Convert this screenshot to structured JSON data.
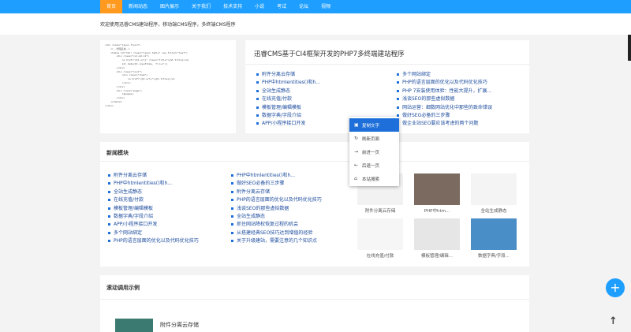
{
  "nav": {
    "items": [
      "首页",
      "新闻动态",
      "图片展示",
      "关于我们",
      "技术支持",
      "小说",
      "考试",
      "论坛",
      "视频"
    ],
    "active_index": 0
  },
  "welcome": {
    "text": "欢迎使用迅睿CMS建站程序，移动端CMS程序，多终端CMS程序"
  },
  "code": {
    "lines": [
      "<div class=\"layui-fluid\">",
      "    <!--代码区块-->",
      "    <table id=\"tbl\" class=\"layui-table\" lay-filter=\"test\">",
      "        <div class=\"col-md-12\">",
      "            <a href=\"{$t.url}\" class=\"title\">{$t.title}</a>",
      "            {dr_date($t.inputtime, 'Y-m-d')}",
      "        </div>",
      "        <div class=\"list\">",
      "            <div class=\"item\">",
      "                <a href=\"{$t.url}\">{$t.title}</a>",
      "            </div>",
      "        </div>",
      "        <div class=\"page\">",
      "            {$pages}",
      "        </div>",
      "    </table>",
      "</div>"
    ]
  },
  "intro": {
    "title": "迅睿CMS基于CI4框架开发的PHP7多终端建站程序",
    "col1": [
      "附件分离云存储",
      "PHP中htmlentities()和h...",
      "全站生成静态",
      "在线充值/付款",
      "模板管理/编辑模板",
      "数据字典/字段介绍",
      "APP/小程序接口开发"
    ],
    "col2": [
      "多个网站绑定",
      "PHP的语言层面的优化以及代码优化技巧",
      "PHP 7安装使用体验：性能大提升，扩展...",
      "浅谈SEO的那些虚拟数据",
      "网站运营：细数网站优化中那些的致命错误",
      "做好SEO必备的三步骤",
      "做企业站SEO要应该考虑的两个问题"
    ]
  },
  "menu": {
    "items": [
      {
        "icon": "copy-icon",
        "glyph": "▣",
        "label": "复制文字"
      },
      {
        "icon": "refresh-icon",
        "glyph": "↻",
        "label": "刷新页面"
      },
      {
        "icon": "forward-icon",
        "glyph": "→",
        "label": "前进一页"
      },
      {
        "icon": "back-icon",
        "glyph": "←",
        "label": "后退一页"
      },
      {
        "icon": "home-search-icon",
        "glyph": "⌂",
        "label": "本站搜索"
      }
    ],
    "active_index": 0
  },
  "news": {
    "title": "新闻模块",
    "col1": [
      "附件分离云存储",
      "PHP中htmlentities()和h...",
      "全站生成静态",
      "在线充值/付款",
      "模板管理/编辑模板",
      "数据字典/字段介绍",
      "APP/小程序接口开发",
      "多个网站绑定",
      "PHP的语言层面的优化以及代码优化技巧"
    ],
    "col2": [
      "PHP中htmlentities()和h...",
      "做好SEO必备的三步骤",
      "附件分离云存储",
      "PHP的语言层面的优化以及代码优化技巧",
      "浅谈SEO的那些虚拟数据",
      "全站生成静态",
      "抓住网站降权恢复过程的机会",
      "从搭建经典SEO技巧达到增值的经验",
      "关于升级建站，需要注意的几个知识点"
    ],
    "thumbs": [
      {
        "caption": "附件分离云存储",
        "color": "#f2f2f2"
      },
      {
        "caption": "PHP中htm...",
        "color": "#7a6a60"
      },
      {
        "caption": "全站生成静态",
        "color": "#f4f4f4"
      },
      {
        "caption": "在线充值/付款",
        "color": "#f6f6f6"
      },
      {
        "caption": "模板管理/编辑...",
        "color": "#e6e6e6"
      },
      {
        "caption": "数据字典/字段...",
        "color": "#4a8ec8"
      }
    ]
  },
  "scroll": {
    "title": "滚动调用示例",
    "item_title": "附件分离云存储"
  },
  "fab": {
    "glyph": "+"
  },
  "totop": {
    "glyph": "↑"
  }
}
